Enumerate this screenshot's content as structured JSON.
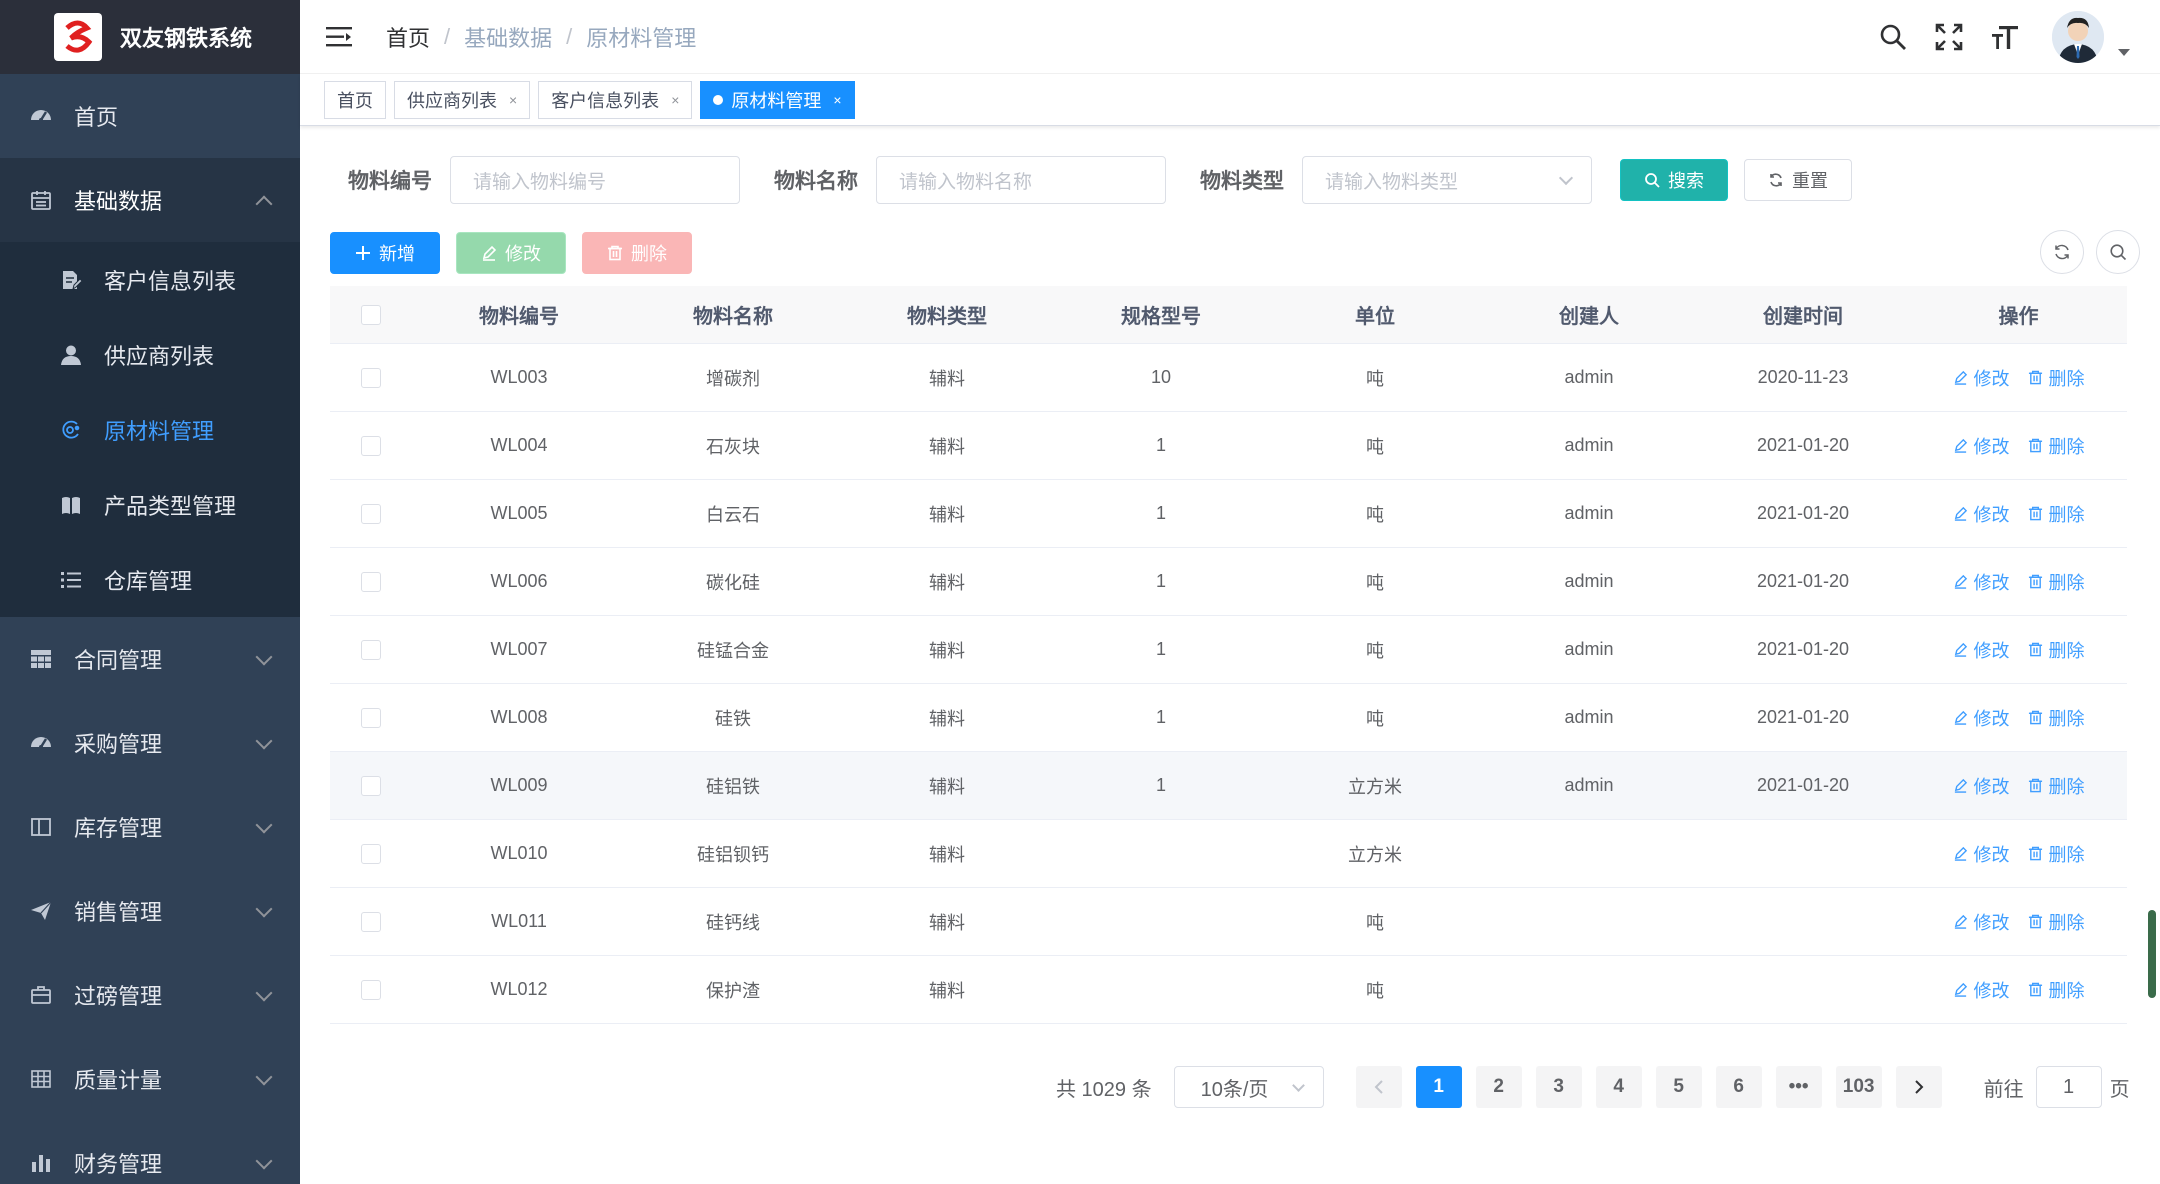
{
  "app": {
    "title": "双友钢铁系统"
  },
  "sidebar": {
    "items": [
      {
        "label": "首页",
        "icon": "dashboard-icon"
      },
      {
        "label": "基础数据",
        "icon": "calendar-icon",
        "open": true,
        "children": [
          {
            "label": "客户信息列表",
            "icon": "edit-doc-icon"
          },
          {
            "label": "供应商列表",
            "icon": "user-icon"
          },
          {
            "label": "原材料管理",
            "icon": "material-icon",
            "active": true
          },
          {
            "label": "产品类型管理",
            "icon": "book-icon"
          },
          {
            "label": "仓库管理",
            "icon": "list-icon"
          }
        ]
      },
      {
        "label": "合同管理",
        "icon": "table-icon"
      },
      {
        "label": "采购管理",
        "icon": "dashboard-icon"
      },
      {
        "label": "库存管理",
        "icon": "panel-icon"
      },
      {
        "label": "销售管理",
        "icon": "send-icon"
      },
      {
        "label": "过磅管理",
        "icon": "briefcase-icon"
      },
      {
        "label": "质量计量",
        "icon": "grid-icon"
      },
      {
        "label": "财务管理",
        "icon": "bar-chart-icon"
      }
    ]
  },
  "breadcrumb": [
    "首页",
    "基础数据",
    "原材料管理"
  ],
  "tags": [
    {
      "label": "首页",
      "closable": false
    },
    {
      "label": "供应商列表",
      "closable": true
    },
    {
      "label": "客户信息列表",
      "closable": true
    },
    {
      "label": "原材料管理",
      "closable": true,
      "active": true
    }
  ],
  "search": {
    "code_label": "物料编号",
    "code_placeholder": "请输入物料编号",
    "name_label": "物料名称",
    "name_placeholder": "请输入物料名称",
    "type_label": "物料类型",
    "type_placeholder": "请输入物料类型",
    "search_btn": "搜索",
    "reset_btn": "重置"
  },
  "actions": {
    "add": "新增",
    "edit": "修改",
    "delete": "删除"
  },
  "table": {
    "headers": [
      "物料编号",
      "物料名称",
      "物料类型",
      "规格型号",
      "单位",
      "创建人",
      "创建时间",
      "操作"
    ],
    "op_edit": "修改",
    "op_delete": "删除",
    "rows": [
      [
        "WL003",
        "增碳剂",
        "辅料",
        "10",
        "吨",
        "admin",
        "2020-11-23"
      ],
      [
        "WL004",
        "石灰块",
        "辅料",
        "1",
        "吨",
        "admin",
        "2021-01-20"
      ],
      [
        "WL005",
        "白云石",
        "辅料",
        "1",
        "吨",
        "admin",
        "2021-01-20"
      ],
      [
        "WL006",
        "碳化硅",
        "辅料",
        "1",
        "吨",
        "admin",
        "2021-01-20"
      ],
      [
        "WL007",
        "硅锰合金",
        "辅料",
        "1",
        "吨",
        "admin",
        "2021-01-20"
      ],
      [
        "WL008",
        "硅铁",
        "辅料",
        "1",
        "吨",
        "admin",
        "2021-01-20"
      ],
      [
        "WL009",
        "硅铝铁",
        "辅料",
        "1",
        "立方米",
        "admin",
        "2021-01-20"
      ],
      [
        "WL010",
        "硅铝钡钙",
        "辅料",
        "",
        "立方米",
        "",
        ""
      ],
      [
        "WL011",
        "硅钙线",
        "辅料",
        "",
        "吨",
        "",
        ""
      ],
      [
        "WL012",
        "保护渣",
        "辅料",
        "",
        "吨",
        "",
        ""
      ]
    ]
  },
  "pagination": {
    "total": "共 1029 条",
    "page_size": "10条/页",
    "pages": [
      "1",
      "2",
      "3",
      "4",
      "5",
      "6",
      "•••",
      "103"
    ],
    "current": "1",
    "goto_label": "前往",
    "goto_value": "1",
    "goto_suffix": "页"
  }
}
